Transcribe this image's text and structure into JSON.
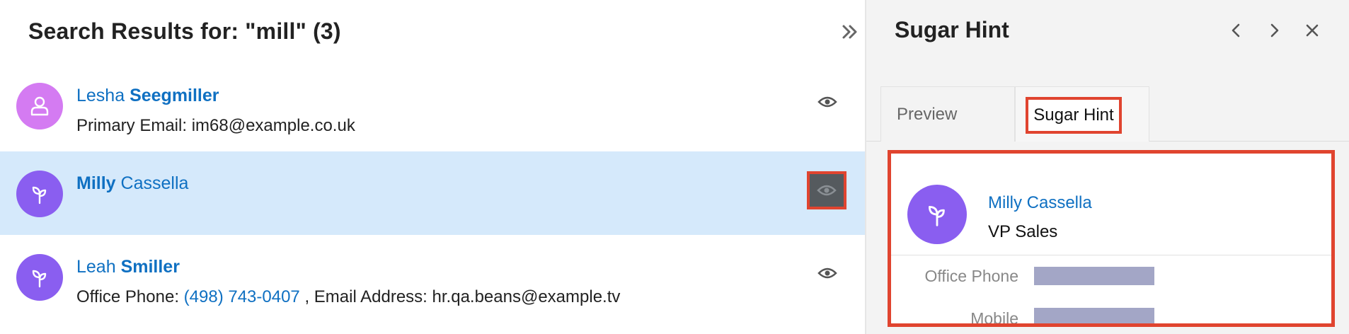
{
  "search": {
    "title": "Search Results for: \"mill\" (3)",
    "results": [
      {
        "first": "Lesha ",
        "last": "Seegmiller",
        "detail_label": "Primary Email: ",
        "detail_value": "im68@example.co.uk",
        "icon": "person-icon"
      },
      {
        "first_bold": "Milly",
        "last": " Cassella",
        "icon": "sprout-icon"
      },
      {
        "first": "Leah ",
        "last": "Smiller",
        "phone_label": "Office Phone: ",
        "phone_value": "(498) 743-0407",
        "email_label": " , Email Address: ",
        "email_value": "hr.qa.beans@example.tv",
        "icon": "sprout-icon"
      }
    ]
  },
  "hint_panel": {
    "title": "Sugar Hint",
    "tabs": [
      {
        "label": "Preview"
      },
      {
        "label": "Sugar Hint"
      }
    ],
    "card": {
      "name": "Milly Cassella",
      "job_title": "VP Sales",
      "fields": [
        {
          "label": "Office Phone"
        },
        {
          "label": "Mobile"
        }
      ]
    }
  },
  "colors": {
    "accent_link": "#0f70c2",
    "highlight_row": "#d5e9fb",
    "annotation_red": "#e0442f",
    "avatar_purple": "#8a5ef0",
    "avatar_pink": "#d47bf2"
  }
}
